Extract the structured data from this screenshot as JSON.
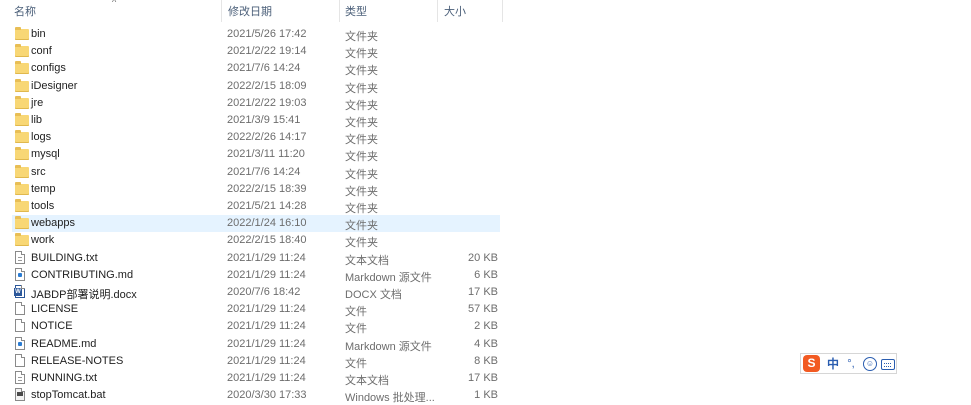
{
  "columns": {
    "name": "名称",
    "modified": "修改日期",
    "type": "类型",
    "size": "大小"
  },
  "files": [
    {
      "name": "bin",
      "date": "2021/5/26 17:42",
      "type": "文件夹",
      "size": "",
      "icon": "folder-icon"
    },
    {
      "name": "conf",
      "date": "2021/2/22 19:14",
      "type": "文件夹",
      "size": "",
      "icon": "folder-icon"
    },
    {
      "name": "configs",
      "date": "2021/7/6 14:24",
      "type": "文件夹",
      "size": "",
      "icon": "folder-icon"
    },
    {
      "name": "iDesigner",
      "date": "2022/2/15 18:09",
      "type": "文件夹",
      "size": "",
      "icon": "folder-icon"
    },
    {
      "name": "jre",
      "date": "2021/2/22 19:03",
      "type": "文件夹",
      "size": "",
      "icon": "folder-icon"
    },
    {
      "name": "lib",
      "date": "2021/3/9 15:41",
      "type": "文件夹",
      "size": "",
      "icon": "folder-icon"
    },
    {
      "name": "logs",
      "date": "2022/2/26 14:17",
      "type": "文件夹",
      "size": "",
      "icon": "folder-icon"
    },
    {
      "name": "mysql",
      "date": "2021/3/11 11:20",
      "type": "文件夹",
      "size": "",
      "icon": "folder-icon"
    },
    {
      "name": "src",
      "date": "2021/7/6 14:24",
      "type": "文件夹",
      "size": "",
      "icon": "folder-icon"
    },
    {
      "name": "temp",
      "date": "2022/2/15 18:39",
      "type": "文件夹",
      "size": "",
      "icon": "folder-icon"
    },
    {
      "name": "tools",
      "date": "2021/5/21 14:28",
      "type": "文件夹",
      "size": "",
      "icon": "folder-icon"
    },
    {
      "name": "webapps",
      "date": "2022/1/24 16:10",
      "type": "文件夹",
      "size": "",
      "icon": "folder-icon",
      "selected": true
    },
    {
      "name": "work",
      "date": "2022/2/15 18:40",
      "type": "文件夹",
      "size": "",
      "icon": "folder-icon"
    },
    {
      "name": "BUILDING.txt",
      "date": "2021/1/29 11:24",
      "type": "文本文档",
      "size": "20 KB",
      "icon": "text-file-icon"
    },
    {
      "name": "CONTRIBUTING.md",
      "date": "2021/1/29 11:24",
      "type": "Markdown 源文件",
      "size": "6 KB",
      "icon": "markdown-file-icon"
    },
    {
      "name": "JABDP部署说明.docx",
      "date": "2020/7/6 18:42",
      "type": "DOCX 文档",
      "size": "17 KB",
      "icon": "word-file-icon"
    },
    {
      "name": "LICENSE",
      "date": "2021/1/29 11:24",
      "type": "文件",
      "size": "57 KB",
      "icon": "file-icon"
    },
    {
      "name": "NOTICE",
      "date": "2021/1/29 11:24",
      "type": "文件",
      "size": "2 KB",
      "icon": "file-icon"
    },
    {
      "name": "README.md",
      "date": "2021/1/29 11:24",
      "type": "Markdown 源文件",
      "size": "4 KB",
      "icon": "markdown-file-icon"
    },
    {
      "name": "RELEASE-NOTES",
      "date": "2021/1/29 11:24",
      "type": "文件",
      "size": "8 KB",
      "icon": "file-icon"
    },
    {
      "name": "RUNNING.txt",
      "date": "2021/1/29 11:24",
      "type": "文本文档",
      "size": "17 KB",
      "icon": "text-file-icon"
    },
    {
      "name": "stopTomcat.bat",
      "date": "2020/3/30 17:33",
      "type": "Windows 批处理...",
      "size": "1 KB",
      "icon": "batch-file-icon"
    }
  ],
  "ime_toolbar": {
    "logo": "S",
    "mode": "中",
    "punct": "°,",
    "emoji": "☺"
  },
  "colors": {
    "selected_row": "#e5f3ff",
    "folder": "#f8d775",
    "header_text": "#4c607a",
    "ime_accent": "#2a5db0",
    "ime_logo": "#f25a22"
  }
}
